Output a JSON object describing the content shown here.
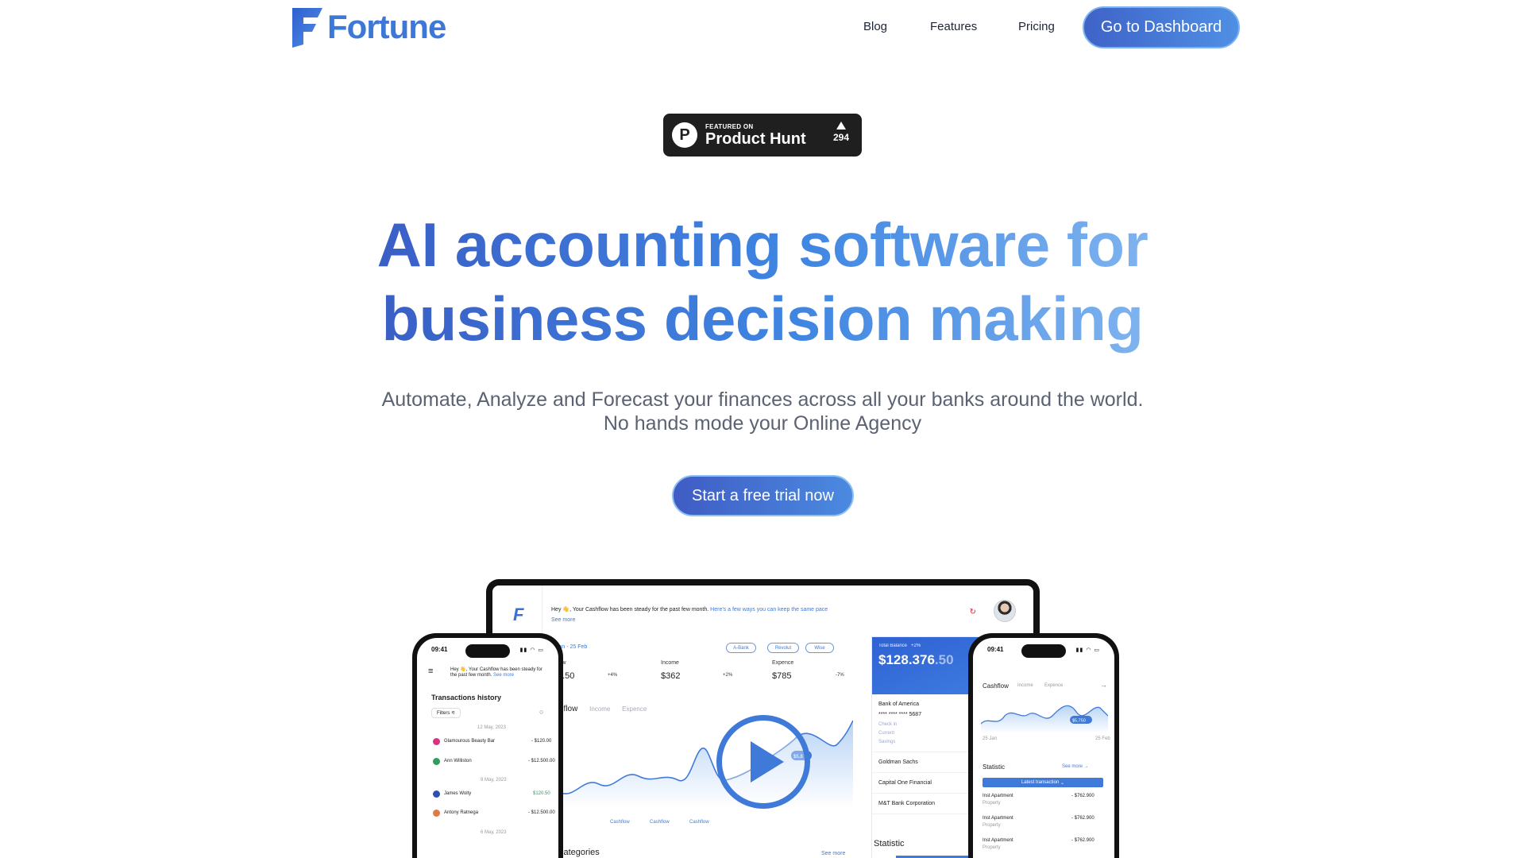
{
  "nav": {
    "brand": "Fortune",
    "links": [
      "Blog",
      "Features",
      "Pricing"
    ],
    "cta": "Go to Dashboard"
  },
  "product_hunt": {
    "small": "FEATURED ON",
    "big": "Product Hunt",
    "votes": "294"
  },
  "hero": {
    "headline_line1": "AI accounting software for",
    "headline_line2": "business decision making",
    "sub_line1": "Automate, Analyze and Forecast your finances across all your banks around the world.",
    "sub_line2": "No hands mode your Online Agency",
    "cta": "Start a free trial now"
  },
  "laptop": {
    "message": "Hey 👋, Your Cashflow has been steady for the past few month.",
    "message_link": "Here's a few ways you can keep the same pace",
    "see_more": "See more",
    "date_range": "Jan - 25 Feb",
    "pills": [
      "A-Bank",
      "Revolut",
      "Wise"
    ],
    "stats": [
      {
        "label": "low",
        "value": "3.50",
        "pct": "+4%"
      },
      {
        "label": "Income",
        "value": "$362",
        "pct": "+2%"
      },
      {
        "label": "Expence",
        "value": "$785",
        "pct": "-7%"
      }
    ],
    "tabs": {
      "active": "hflow",
      "others": [
        "Income",
        "Expence"
      ]
    },
    "chart_badge": "$5,8",
    "legend": [
      "Cashflow",
      "Cashflow",
      "Cashflow"
    ],
    "categories": "categories",
    "categories_more": "See more",
    "panel": {
      "title": "Total Balance",
      "change": "+2%",
      "amount_main": "$128.376",
      "amount_cents": ".50",
      "banks": [
        "Bank of America",
        "Goldman Sachs",
        "Capital One Financial",
        "M&T Bank Corporation"
      ],
      "card_number": "**** **** **** 5687",
      "sub_items": [
        "Check in",
        "Current",
        "Savings"
      ],
      "statistic": "Statistic"
    }
  },
  "phone_left": {
    "time": "09:41",
    "message": "Hey 👋, Your Cashflow has been steady for",
    "message2": "the past few month.",
    "see_more": "See more",
    "title": "Transactions history",
    "filters": "Filters",
    "groups": [
      {
        "date": "12 May, 2023",
        "items": [
          {
            "name": "Glamourous Beauty Bar",
            "amount": "- $120.00",
            "color": "#d63384"
          },
          {
            "name": "Ann Williston",
            "amount": "- $12.500.00",
            "color": "#2e9e5b"
          }
        ]
      },
      {
        "date": "8 May, 2023",
        "items": [
          {
            "name": "James Wolty",
            "amount": "$120.50",
            "color": "#2f4fb3",
            "positive": true
          },
          {
            "name": "Antony Ratnega",
            "amount": "- $12.500.00",
            "color": "#e07a3f"
          }
        ]
      },
      {
        "date": "6 May, 2023",
        "items": []
      }
    ]
  },
  "phone_right": {
    "time": "09:41",
    "tabs": [
      "Cashflow",
      "Income",
      "Expence"
    ],
    "badge": "$5,750",
    "x_start": "25 Jan",
    "x_end": "25 Feb",
    "statistic": "Statistic",
    "see_more": "See more",
    "latest": "Latest transaction",
    "rows": [
      {
        "name": "Inst Apartment",
        "sub": "Property",
        "amount": "- $762.900"
      },
      {
        "name": "Inst Apartment",
        "sub": "Property",
        "amount": "- $762.900"
      },
      {
        "name": "Inst Apartment",
        "sub": "Property",
        "amount": "- $762.900"
      }
    ]
  },
  "colors": {
    "brand_blue": "#3d78d8",
    "button_start": "#3f5cc4",
    "button_end": "#4b8ae0",
    "text_muted": "#5b6272"
  }
}
